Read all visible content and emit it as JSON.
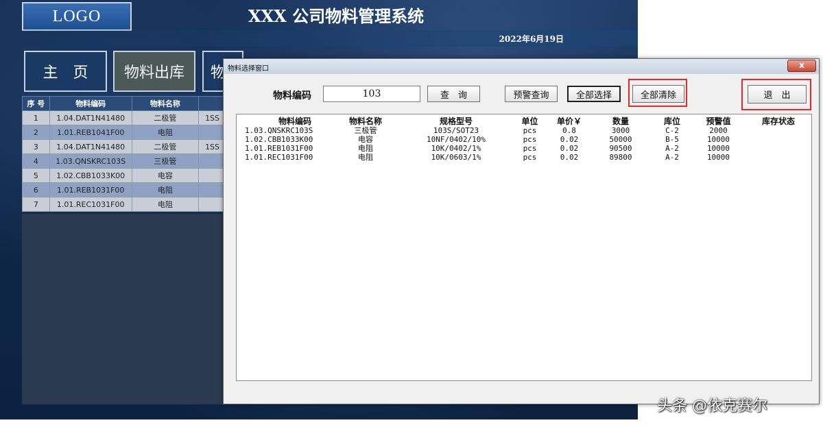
{
  "header": {
    "logo": "LOGO",
    "title": "XXX 公司物料管理系统",
    "date": "2022年6月19日"
  },
  "nav": {
    "home": "主　页",
    "outbound": "物料出库",
    "third": "物"
  },
  "grid": {
    "columns": [
      "序 号",
      "物料编码",
      "物料名称",
      ""
    ],
    "rows": [
      {
        "seq": "1",
        "code": "1.04.DAT1N41480",
        "name": "二极管",
        "spec": "1SS"
      },
      {
        "seq": "2",
        "code": "1.01.REB1041F00",
        "name": "电阻",
        "spec": ""
      },
      {
        "seq": "3",
        "code": "1.04.DAT1N41480",
        "name": "二极管",
        "spec": "1SS"
      },
      {
        "seq": "4",
        "code": "1.03.QNSKRC103S",
        "name": "三极管",
        "spec": ""
      },
      {
        "seq": "5",
        "code": "1.02.CBB1033K00",
        "name": "电容",
        "spec": ""
      },
      {
        "seq": "6",
        "code": "1.01.REB1031F00",
        "name": "电阻",
        "spec": ""
      },
      {
        "seq": "7",
        "code": "1.01.REC1031F00",
        "name": "电阻",
        "spec": ""
      }
    ]
  },
  "dialog": {
    "title": "物料选择窗口",
    "close": "x",
    "code_label": "物料编码",
    "code_value": "103",
    "btn_query": "查　询",
    "btn_alert_query": "预警查询",
    "btn_select_all": "全部选择",
    "btn_clear_all": "全部清除",
    "btn_exit": "退　出",
    "list_headers": [
      "物料编码",
      "物料名称",
      "规格型号",
      "单位",
      "单价￥",
      "数量",
      "库位",
      "预警值",
      "库存状态"
    ],
    "list_rows": [
      [
        "1.03.QNSKRC103S",
        "三极管",
        "103S/SOT23",
        "pcs",
        "0.8",
        "3000",
        "C-2",
        "2000",
        ""
      ],
      [
        "1.02.CBB1033K00",
        "电容",
        "10NF/0402/10%",
        "pcs",
        "0.02",
        "50000",
        "B-5",
        "10000",
        ""
      ],
      [
        "1.01.REB1031F00",
        "电阻",
        "10K/0402/1%",
        "pcs",
        "0.02",
        "90500",
        "A-2",
        "10000",
        ""
      ],
      [
        "1.01.REC1031F00",
        "电阻",
        "10K/0603/1%",
        "pcs",
        "0.02",
        "89800",
        "A-2",
        "10000",
        ""
      ]
    ]
  },
  "watermark": "头条 @依克赛尔",
  "colors": {
    "app_bg": "#0f2748",
    "header_cell": "#2b4b78",
    "row_light": "#c9ced6",
    "row_dark": "#8ea3c4",
    "highlight": "#e52727"
  }
}
